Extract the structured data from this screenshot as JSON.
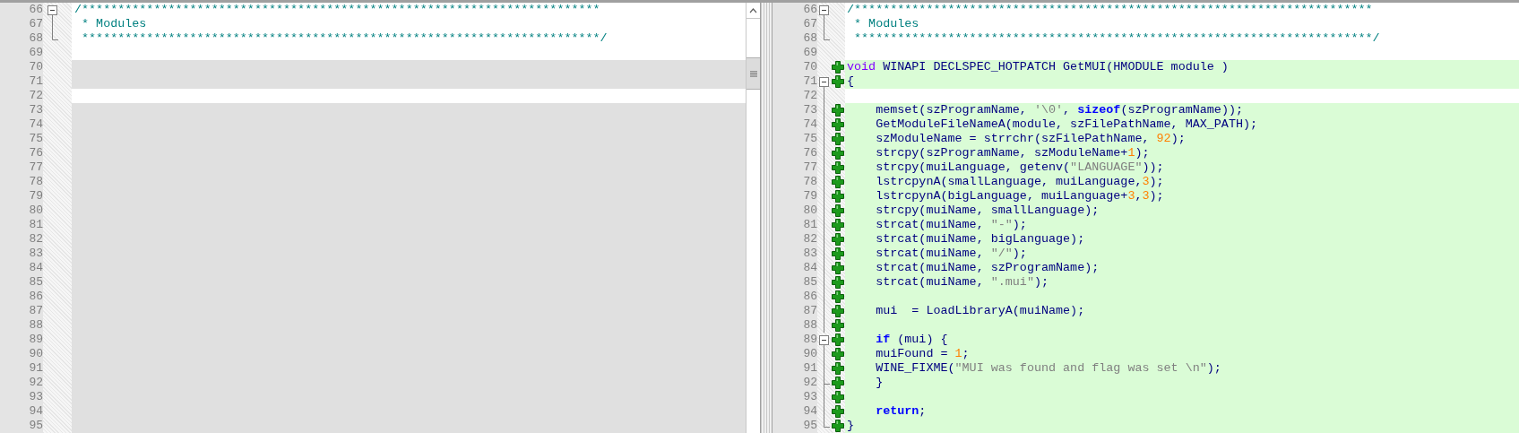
{
  "left_pane": {
    "lines": [
      {
        "number": "66",
        "kind": "text",
        "fold": {
          "kind": "open"
        },
        "segments": [
          {
            "text": "/************************************************************************",
            "kind": "comment"
          }
        ]
      },
      {
        "number": "67",
        "kind": "text",
        "fold": {
          "kind": "line"
        },
        "segments": [
          {
            "text": " * Modules",
            "kind": "comment"
          }
        ]
      },
      {
        "number": "68",
        "kind": "text",
        "fold": {
          "kind": "end"
        },
        "segments": [
          {
            "text": " ************************************************************************/",
            "kind": "comment"
          }
        ]
      },
      {
        "number": "69",
        "kind": "blank"
      },
      {
        "number": "70",
        "kind": "placeholder"
      },
      {
        "number": "71",
        "kind": "placeholder"
      },
      {
        "number": "72",
        "kind": "blank"
      },
      {
        "number": "73",
        "kind": "placeholder"
      },
      {
        "number": "74",
        "kind": "placeholder"
      },
      {
        "number": "75",
        "kind": "placeholder"
      },
      {
        "number": "76",
        "kind": "placeholder"
      },
      {
        "number": "77",
        "kind": "placeholder"
      },
      {
        "number": "78",
        "kind": "placeholder"
      },
      {
        "number": "79",
        "kind": "placeholder"
      },
      {
        "number": "80",
        "kind": "placeholder"
      },
      {
        "number": "81",
        "kind": "placeholder"
      },
      {
        "number": "82",
        "kind": "placeholder"
      },
      {
        "number": "83",
        "kind": "placeholder"
      },
      {
        "number": "84",
        "kind": "placeholder"
      },
      {
        "number": "85",
        "kind": "placeholder"
      },
      {
        "number": "86",
        "kind": "placeholder"
      },
      {
        "number": "87",
        "kind": "placeholder"
      },
      {
        "number": "88",
        "kind": "placeholder"
      },
      {
        "number": "89",
        "kind": "placeholder"
      },
      {
        "number": "90",
        "kind": "placeholder"
      },
      {
        "number": "91",
        "kind": "placeholder"
      },
      {
        "number": "92",
        "kind": "placeholder"
      },
      {
        "number": "93",
        "kind": "placeholder"
      },
      {
        "number": "94",
        "kind": "placeholder"
      },
      {
        "number": "95",
        "kind": "placeholder"
      }
    ]
  },
  "right_pane": {
    "lines": [
      {
        "number": "66",
        "added": false,
        "fold": {
          "kind": "open"
        },
        "segments": [
          {
            "text": "/************************************************************************",
            "kind": "comment"
          }
        ]
      },
      {
        "number": "67",
        "added": false,
        "fold": {
          "kind": "line"
        },
        "segments": [
          {
            "text": " * Modules",
            "kind": "comment"
          }
        ]
      },
      {
        "number": "68",
        "added": false,
        "fold": {
          "kind": "end"
        },
        "segments": [
          {
            "text": " ************************************************************************/",
            "kind": "comment"
          }
        ]
      },
      {
        "number": "69",
        "added": false
      },
      {
        "number": "70",
        "added": true,
        "segments": [
          {
            "text": "void",
            "kind": "type"
          },
          {
            "text": " WINAPI DECLSPEC_HOTPATCH GetMUI(HMODULE module )",
            "kind": "plain"
          }
        ]
      },
      {
        "number": "71",
        "added": true,
        "fold": {
          "kind": "open"
        },
        "segments": [
          {
            "text": "{",
            "kind": "plain"
          }
        ]
      },
      {
        "number": "72",
        "added": false,
        "fold": {
          "kind": "line"
        }
      },
      {
        "number": "73",
        "added": true,
        "fold": {
          "kind": "line"
        },
        "segments": [
          {
            "text": "    memset(szProgramName, ",
            "kind": "plain"
          },
          {
            "text": "'\\0'",
            "kind": "string"
          },
          {
            "text": ", ",
            "kind": "plain"
          },
          {
            "text": "sizeof",
            "kind": "keyword"
          },
          {
            "text": "(szProgramName));",
            "kind": "plain"
          }
        ]
      },
      {
        "number": "74",
        "added": true,
        "fold": {
          "kind": "line"
        },
        "segments": [
          {
            "text": "    GetModuleFileNameA(module, szFilePathName, MAX_PATH);",
            "kind": "plain"
          }
        ]
      },
      {
        "number": "75",
        "added": true,
        "fold": {
          "kind": "line"
        },
        "segments": [
          {
            "text": "    szModuleName = strrchr(szFilePathName, ",
            "kind": "plain"
          },
          {
            "text": "92",
            "kind": "number"
          },
          {
            "text": ");",
            "kind": "plain"
          }
        ]
      },
      {
        "number": "76",
        "added": true,
        "fold": {
          "kind": "line"
        },
        "segments": [
          {
            "text": "    strcpy(szProgramName, szModuleName+",
            "kind": "plain"
          },
          {
            "text": "1",
            "kind": "number"
          },
          {
            "text": ");",
            "kind": "plain"
          }
        ]
      },
      {
        "number": "77",
        "added": true,
        "fold": {
          "kind": "line"
        },
        "segments": [
          {
            "text": "    strcpy(muiLanguage, getenv(",
            "kind": "plain"
          },
          {
            "text": "\"LANGUAGE\"",
            "kind": "string"
          },
          {
            "text": "));",
            "kind": "plain"
          }
        ]
      },
      {
        "number": "78",
        "added": true,
        "fold": {
          "kind": "line"
        },
        "segments": [
          {
            "text": "    lstrcpynA(smallLanguage, muiLanguage,",
            "kind": "plain"
          },
          {
            "text": "3",
            "kind": "number"
          },
          {
            "text": ");",
            "kind": "plain"
          }
        ]
      },
      {
        "number": "79",
        "added": true,
        "fold": {
          "kind": "line"
        },
        "segments": [
          {
            "text": "    lstrcpynA(bigLanguage, muiLanguage+",
            "kind": "plain"
          },
          {
            "text": "3",
            "kind": "number"
          },
          {
            "text": ",",
            "kind": "plain"
          },
          {
            "text": "3",
            "kind": "number"
          },
          {
            "text": ");",
            "kind": "plain"
          }
        ]
      },
      {
        "number": "80",
        "added": true,
        "fold": {
          "kind": "line"
        },
        "segments": [
          {
            "text": "    strcpy(muiName, smallLanguage);",
            "kind": "plain"
          }
        ]
      },
      {
        "number": "81",
        "added": true,
        "fold": {
          "kind": "line"
        },
        "segments": [
          {
            "text": "    strcat(muiName, ",
            "kind": "plain"
          },
          {
            "text": "\"-\"",
            "kind": "string"
          },
          {
            "text": ");",
            "kind": "plain"
          }
        ]
      },
      {
        "number": "82",
        "added": true,
        "fold": {
          "kind": "line"
        },
        "segments": [
          {
            "text": "    strcat(muiName, bigLanguage);",
            "kind": "plain"
          }
        ]
      },
      {
        "number": "83",
        "added": true,
        "fold": {
          "kind": "line"
        },
        "segments": [
          {
            "text": "    strcat(muiName, ",
            "kind": "plain"
          },
          {
            "text": "\"/\"",
            "kind": "string"
          },
          {
            "text": ");",
            "kind": "plain"
          }
        ]
      },
      {
        "number": "84",
        "added": true,
        "fold": {
          "kind": "line"
        },
        "segments": [
          {
            "text": "    strcat(muiName, szProgramName);",
            "kind": "plain"
          }
        ]
      },
      {
        "number": "85",
        "added": true,
        "fold": {
          "kind": "line"
        },
        "segments": [
          {
            "text": "    strcat(muiName, ",
            "kind": "plain"
          },
          {
            "text": "\".mui\"",
            "kind": "string"
          },
          {
            "text": ");",
            "kind": "plain"
          }
        ]
      },
      {
        "number": "86",
        "added": true,
        "fold": {
          "kind": "line"
        }
      },
      {
        "number": "87",
        "added": true,
        "fold": {
          "kind": "line"
        },
        "segments": [
          {
            "text": "    mui  = LoadLibraryA(muiName);",
            "kind": "plain"
          }
        ]
      },
      {
        "number": "88",
        "added": true,
        "fold": {
          "kind": "line"
        }
      },
      {
        "number": "89",
        "added": true,
        "fold": {
          "kind": "open"
        },
        "segments": [
          {
            "text": "    if",
            "kind": "keyword"
          },
          {
            "text": " (mui) {",
            "kind": "plain"
          }
        ]
      },
      {
        "number": "90",
        "added": true,
        "fold": {
          "kind": "line"
        },
        "segments": [
          {
            "text": "    muiFound = ",
            "kind": "plain"
          },
          {
            "text": "1",
            "kind": "number"
          },
          {
            "text": ";",
            "kind": "plain"
          }
        ]
      },
      {
        "number": "91",
        "added": true,
        "fold": {
          "kind": "line"
        },
        "segments": [
          {
            "text": "    WINE_FIXME(",
            "kind": "plain"
          },
          {
            "text": "\"MUI was found and flag was set \\n\"",
            "kind": "string"
          },
          {
            "text": ");",
            "kind": "plain"
          }
        ]
      },
      {
        "number": "92",
        "added": true,
        "fold": {
          "kind": "tee"
        },
        "segments": [
          {
            "text": "    }",
            "kind": "plain"
          }
        ]
      },
      {
        "number": "93",
        "added": true,
        "fold": {
          "kind": "line"
        }
      },
      {
        "number": "94",
        "added": true,
        "fold": {
          "kind": "line"
        },
        "segments": [
          {
            "text": "    return",
            "kind": "keyword"
          },
          {
            "text": ";",
            "kind": "plain"
          }
        ]
      },
      {
        "number": "95",
        "added": true,
        "fold": {
          "kind": "end"
        },
        "segments": [
          {
            "text": "}",
            "kind": "plain"
          }
        ]
      }
    ]
  }
}
